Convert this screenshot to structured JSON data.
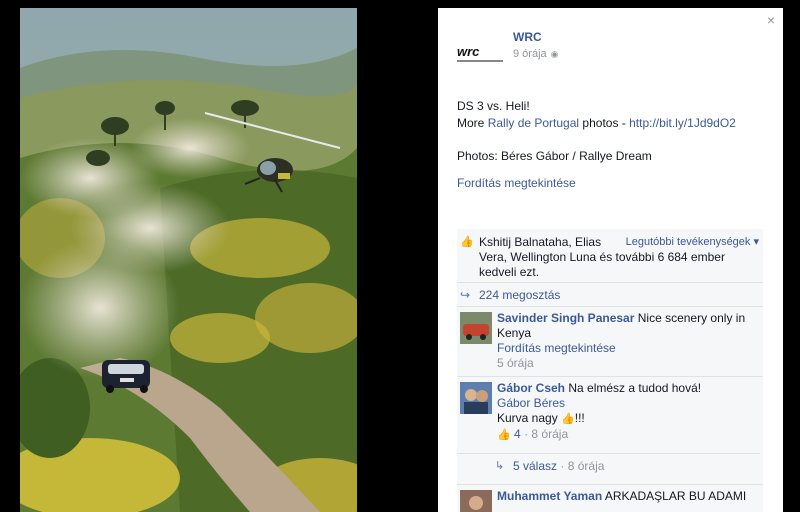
{
  "colors": {
    "link_blue": "#3b5998",
    "muted_gray": "#90949c",
    "panel_bg": "#f6f7f9"
  },
  "page": {
    "name": "WRC",
    "time": "9 órája",
    "logo_icon": "wrc-logo",
    "privacy_icon": "globe-icon"
  },
  "post": {
    "line1": "DS 3 vs. Heli!",
    "line2_prefix": "More",
    "line2_link": "Rally de Portugal",
    "line2_mid": "photos -",
    "line2_url": "http://bit.ly/1Jd9dO2",
    "line3": "Photos: Béres Gábor / Rallye Dream",
    "translate": "Fordítás megtekintése"
  },
  "likes": {
    "names_line1": "Kshitij Balnataha, Elias",
    "names_line2": "Vera, Wellington Luna és további 6 684 ember kedveli ezt.",
    "sort_label": "Legutóbbi tevékenységek ▾"
  },
  "shares": {
    "label": "224 megosztás"
  },
  "comments": [
    {
      "author": "Savinder Singh Panesar",
      "text": "Nice scenery only in Kenya",
      "translate": "Fordítás megtekintése",
      "time": "5 órája"
    },
    {
      "author": "Gábor Cseh",
      "text": "Na elmész a tudod hová!",
      "tag": "Gábor Béres",
      "line2_text": "Kurva nagy",
      "line2_suffix": "!!!",
      "like_count": "4",
      "time": "8 órája",
      "replies": "5 válasz",
      "reply_time": "8 órája"
    },
    {
      "author": "Muhammet Yaman",
      "text": "ARKADAŞLAR BU ADAMI"
    }
  ],
  "close_label": "×"
}
